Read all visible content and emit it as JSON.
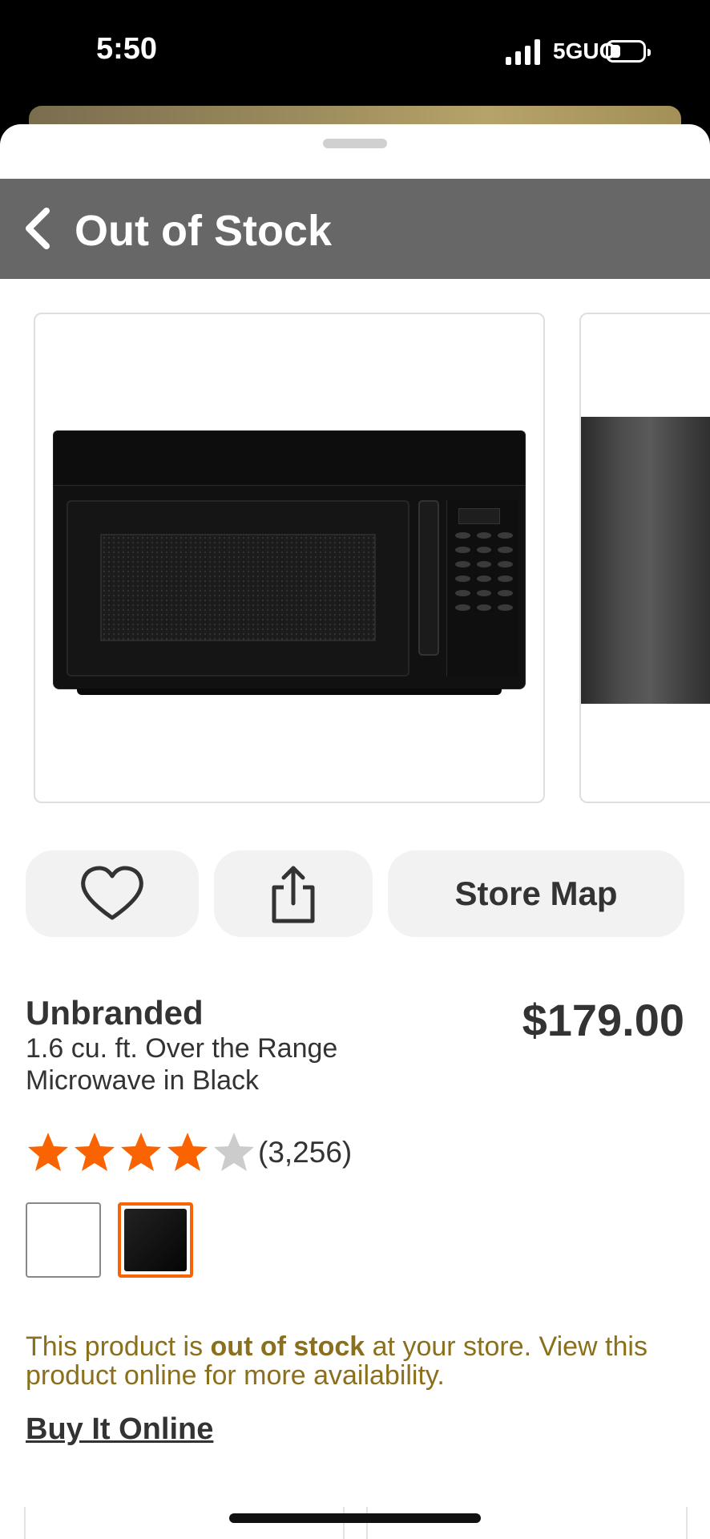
{
  "status_bar": {
    "time": "5:50",
    "network": "5GUC",
    "icons": [
      "signal-icon",
      "battery-icon"
    ]
  },
  "header": {
    "title": "Out of Stock",
    "back_icon": "chevron-left-icon",
    "background_color": "#676767"
  },
  "actions": {
    "favorite_icon": "heart-icon",
    "share_icon": "share-icon",
    "store_map_label": "Store Map"
  },
  "product": {
    "brand": "Unbranded",
    "title": "1.6 cu. ft. Over the Range Microwave in Black",
    "price": "$179.00",
    "rating": 4,
    "rating_max": 5,
    "review_count": "(3,256)",
    "swatches": [
      {
        "name": "White",
        "selected": false
      },
      {
        "name": "Black",
        "selected": true
      }
    ]
  },
  "availability": {
    "message_prefix": "This product is ",
    "message_bold": "out of stock",
    "message_suffix": " at your store. View this product online for more availability.",
    "link_label": "Buy It Online"
  },
  "colors": {
    "accent": "#f96302",
    "availability_text": "#8a6f1c",
    "star_filled": "#f96302",
    "star_empty": "#cccccc"
  }
}
